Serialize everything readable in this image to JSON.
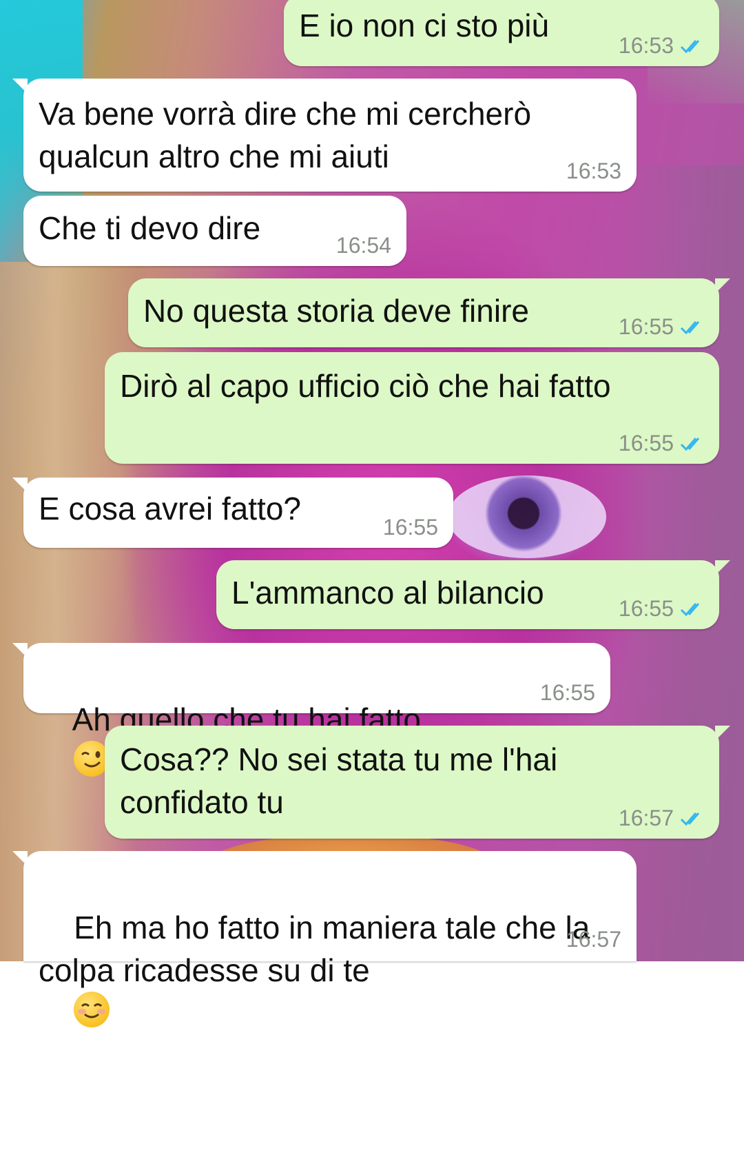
{
  "colors": {
    "incoming_bubble": "#ffffff",
    "outgoing_bubble": "#dcf8c6",
    "timestamp": "#8a8f8a",
    "read_ticks": "#34b7f1"
  },
  "icons": {
    "read_receipt": "double-check-icon"
  },
  "messages": [
    {
      "direction": "out",
      "text": "E io non ci sto più",
      "time": "16:53",
      "status": "read"
    },
    {
      "direction": "in",
      "text": "Va bene vorrà dire che mi cercherò\nqualcun altro che mi aiuti",
      "time": "16:53"
    },
    {
      "direction": "in",
      "text": "Che ti devo dire",
      "time": "16:54"
    },
    {
      "direction": "out",
      "text": "No questa storia deve finire",
      "time": "16:55",
      "status": "read"
    },
    {
      "direction": "out",
      "text": "Dirò al capo ufficio ciò che hai fatto",
      "time": "16:55",
      "status": "read"
    },
    {
      "direction": "in",
      "text": "E cosa avrei fatto?",
      "time": "16:55"
    },
    {
      "direction": "out",
      "text": "L'ammanco al bilancio",
      "time": "16:55",
      "status": "read"
    },
    {
      "direction": "in",
      "text": "Ah quello che tu hai fatto",
      "emoji": "winking-face-emoji",
      "time": "16:55"
    },
    {
      "direction": "out",
      "text": "Cosa?? No sei stata tu me l'hai\nconfidato tu",
      "time": "16:57",
      "status": "read"
    },
    {
      "direction": "in",
      "text": "Eh ma ho fatto in maniera tale che la\ncolpa ricadesse su di te",
      "emoji": "smiling-face-emoji",
      "time": "16:57"
    }
  ]
}
